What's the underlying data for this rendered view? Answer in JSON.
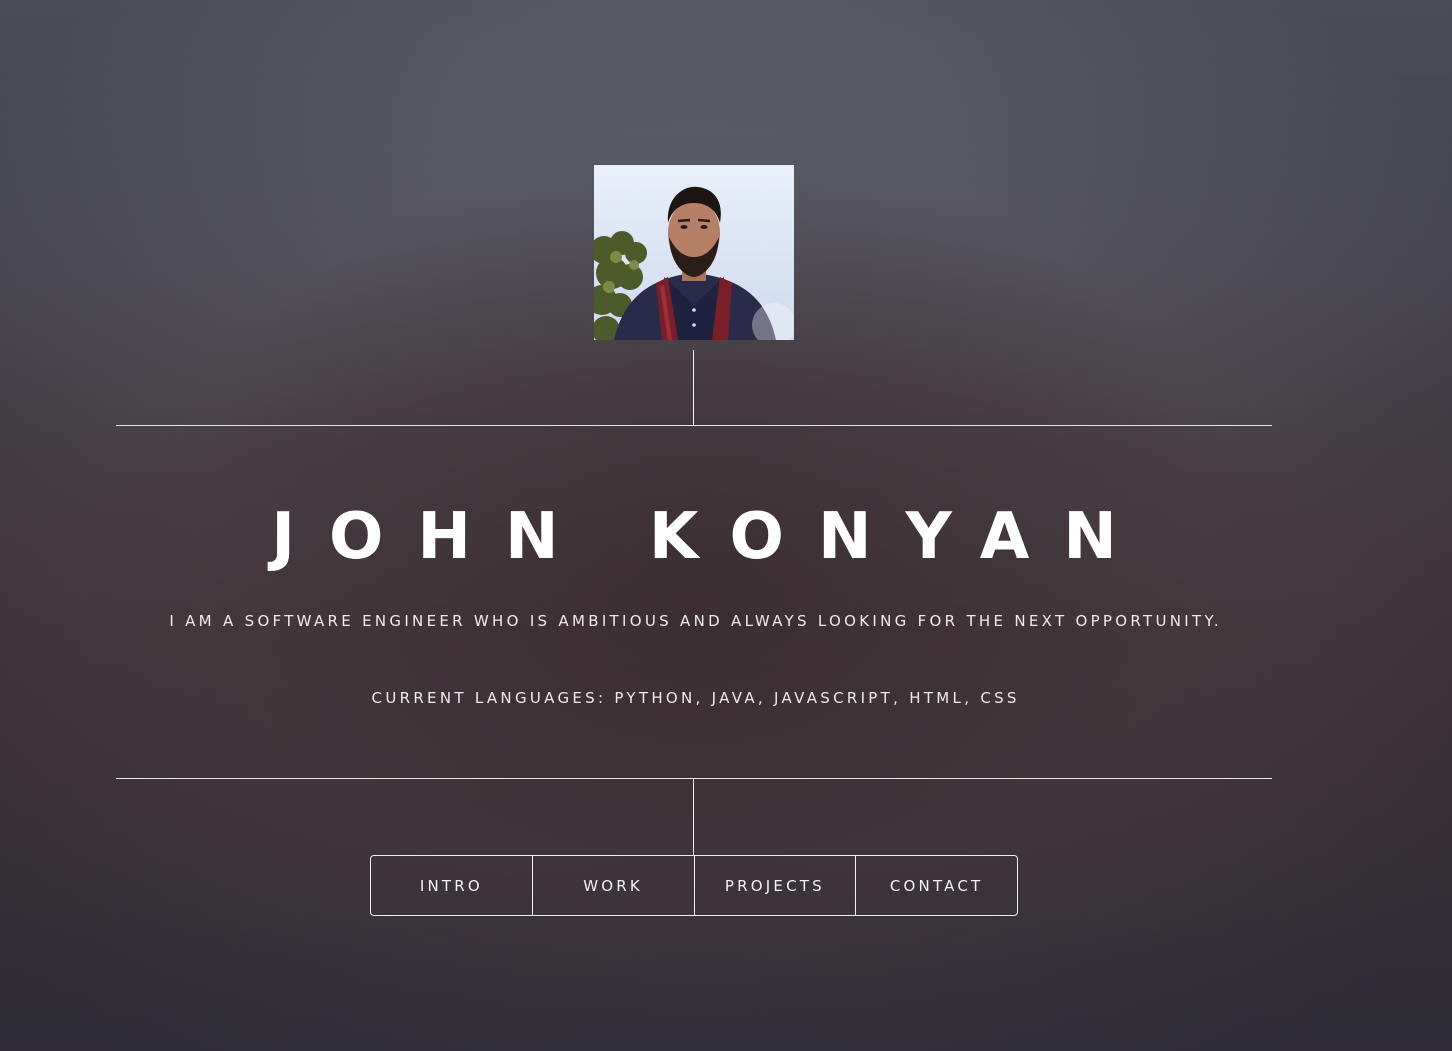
{
  "profile": {
    "name": "JOHN KONYAN",
    "tagline": "I AM A SOFTWARE ENGINEER WHO IS AMBITIOUS AND ALWAYS LOOKING FOR THE NEXT OPPORTUNITY.",
    "languages": "CURRENT LANGUAGES: PYTHON, JAVA, JAVASCRIPT, HTML, CSS"
  },
  "nav": {
    "items": [
      {
        "label": "INTRO"
      },
      {
        "label": "WORK"
      },
      {
        "label": "PROJECTS"
      },
      {
        "label": "CONTACT"
      }
    ]
  },
  "colors": {
    "text": "#ffffff",
    "lines": "#e6e6e6",
    "background_top": "#5c5f6a",
    "background_bottom": "#36333c"
  }
}
